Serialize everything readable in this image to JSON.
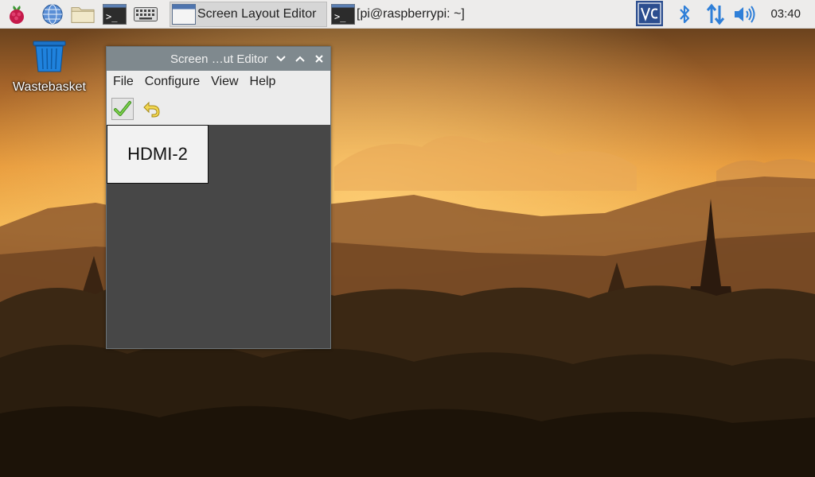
{
  "taskbar": {
    "launchers": [
      {
        "icon": "raspberry-icon"
      },
      {
        "icon": "globe-icon"
      },
      {
        "icon": "folder-icon"
      },
      {
        "icon": "terminal-icon"
      },
      {
        "icon": "keyboard-icon"
      }
    ],
    "tasks": [
      {
        "label": "Screen Layout Editor",
        "icon": "window-icon",
        "active": true
      },
      {
        "label": "[pi@raspberrypi: ~]",
        "icon": "terminal-icon",
        "active": false
      }
    ],
    "tray": [
      {
        "icon": "vnc-icon"
      },
      {
        "icon": "bluetooth-icon"
      },
      {
        "icon": "network-arrows-icon"
      },
      {
        "icon": "volume-icon"
      }
    ],
    "clock": "03:40"
  },
  "desktop": {
    "trash_label": "Wastebasket"
  },
  "window": {
    "title": "Screen …ut Editor",
    "menu": [
      "File",
      "Configure",
      "View",
      "Help"
    ],
    "toolbar": [
      {
        "icon": "checkmark-icon",
        "name": "apply"
      },
      {
        "icon": "undo-arrow-icon",
        "name": "revert"
      }
    ],
    "monitor_label": "HDMI-2"
  },
  "colors": {
    "titlebar": "#7f898e",
    "canvas": "#474747",
    "taskbar": "#edeceb",
    "sky_top": "#5a3a1a",
    "sky_glow": "#f7b24a"
  }
}
